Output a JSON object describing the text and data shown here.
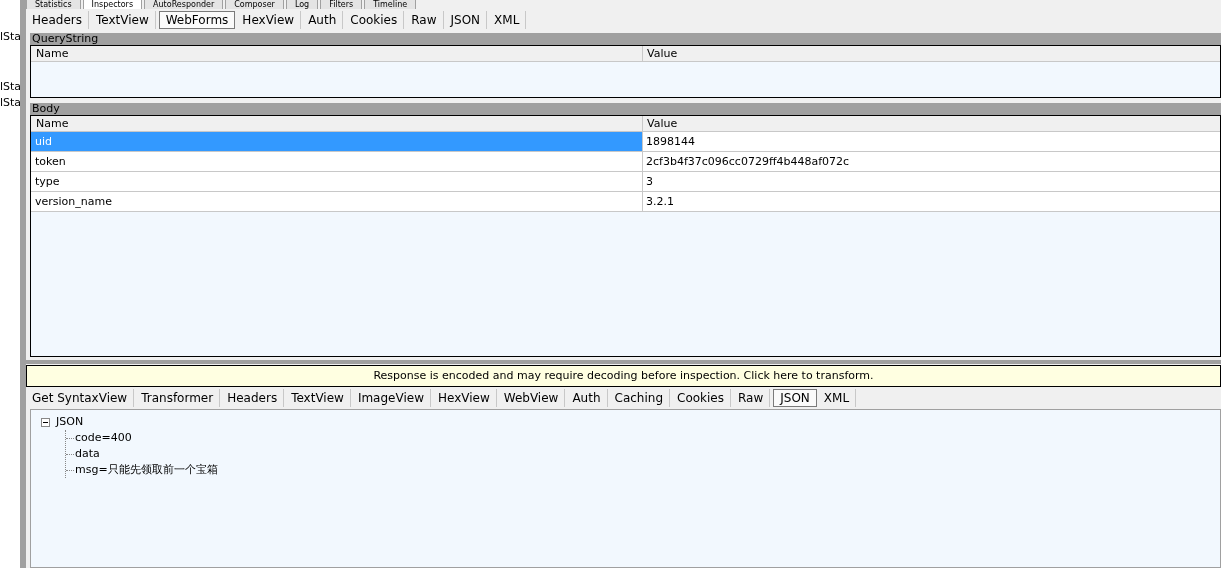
{
  "top_tabs": [
    {
      "label": "Statistics",
      "selected": false
    },
    {
      "label": "Inspectors",
      "selected": true
    },
    {
      "label": "AutoResponder",
      "selected": false
    },
    {
      "label": "Composer",
      "selected": false
    },
    {
      "label": "Log",
      "selected": false
    },
    {
      "label": "Filters",
      "selected": false
    },
    {
      "label": "Timeline",
      "selected": false
    }
  ],
  "left_panel": {
    "items": [
      "lSta",
      "lSta",
      "lSta"
    ]
  },
  "request_tabs": [
    {
      "label": "Headers",
      "selected": false
    },
    {
      "label": "TextView",
      "selected": false
    },
    {
      "label": "WebForms",
      "selected": true
    },
    {
      "label": "HexView",
      "selected": false
    },
    {
      "label": "Auth",
      "selected": false
    },
    {
      "label": "Cookies",
      "selected": false
    },
    {
      "label": "Raw",
      "selected": false
    },
    {
      "label": "JSON",
      "selected": false
    },
    {
      "label": "XML",
      "selected": false
    }
  ],
  "query_string": {
    "title": "QueryString",
    "columns": [
      "Name",
      "Value"
    ]
  },
  "body": {
    "title": "Body",
    "columns": [
      "Name",
      "Value"
    ],
    "rows": [
      {
        "name": "uid",
        "value": "1898144",
        "selected": true
      },
      {
        "name": "token",
        "value": "2cf3b4f37c096cc0729ff4b448af072c",
        "selected": false
      },
      {
        "name": "type",
        "value": "3",
        "selected": false
      },
      {
        "name": "version_name",
        "value": "3.2.1",
        "selected": false
      }
    ]
  },
  "banner": "Response is encoded and may require decoding before inspection. Click here to transform.",
  "response_tabs": [
    {
      "label": "Get SyntaxView",
      "selected": false
    },
    {
      "label": "Transformer",
      "selected": false
    },
    {
      "label": "Headers",
      "selected": false
    },
    {
      "label": "TextView",
      "selected": false
    },
    {
      "label": "ImageView",
      "selected": false
    },
    {
      "label": "HexView",
      "selected": false
    },
    {
      "label": "WebView",
      "selected": false
    },
    {
      "label": "Auth",
      "selected": false
    },
    {
      "label": "Caching",
      "selected": false
    },
    {
      "label": "Cookies",
      "selected": false
    },
    {
      "label": "Raw",
      "selected": false
    },
    {
      "label": "JSON",
      "selected": true
    },
    {
      "label": "XML",
      "selected": false
    }
  ],
  "tree": {
    "label": "JSON",
    "expanded": true,
    "children": [
      {
        "label": "code=400"
      },
      {
        "label": "data"
      },
      {
        "label": "msg=只能先领取前一个宝箱"
      }
    ]
  }
}
